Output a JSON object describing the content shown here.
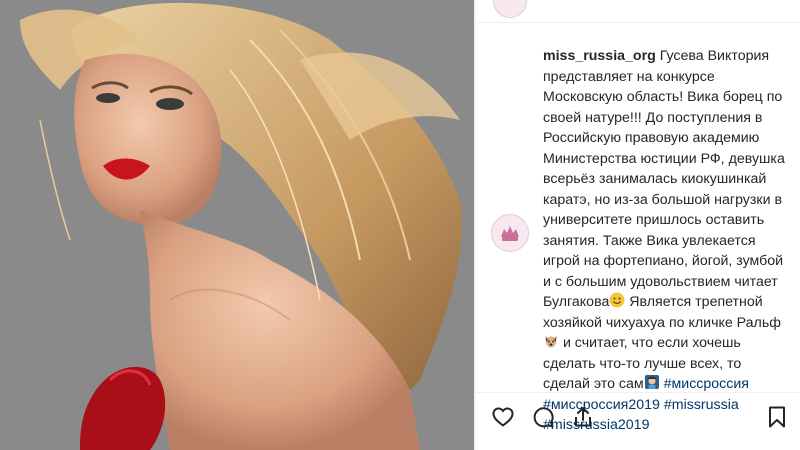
{
  "post": {
    "username": "miss_russia_org",
    "caption": {
      "t1": "Гусева Виктория представляет на конкурсе Московскую область! Вика борец по своей натуре!!! До поступления в Российскую правовую академию Министерства юстиции РФ, девушка всерьёз занималась киокушинкай каратэ, но из-за большой нагрузки в университете пришлось оставить занятия. Также Вика увлекается игрой на фортепиано, йогой, зумбой и с большим удовольствием читает Булгакова",
      "t2": " Является трепетной хозяйкой чихуахуа по кличке Ральф ",
      "t3": " и считает, что если хочешь сделать что-то лучше всех, то сделай это сам",
      "tags": [
        "#миссроссия",
        "#миссроссия2019",
        "#missrussia",
        "#missrussia2019"
      ]
    },
    "emojis": [
      "smiling-face-icon",
      "dog-face-icon",
      "woman-raising-hand-icon"
    ]
  },
  "actions": [
    "like-heart-icon",
    "comment-icon",
    "share-icon",
    "save-bookmark-icon"
  ],
  "colors": {
    "text": "#262626",
    "hashtag": "#00376b",
    "border": "#efefef",
    "lips": "#c8141e",
    "hair": "#d8b07a"
  }
}
